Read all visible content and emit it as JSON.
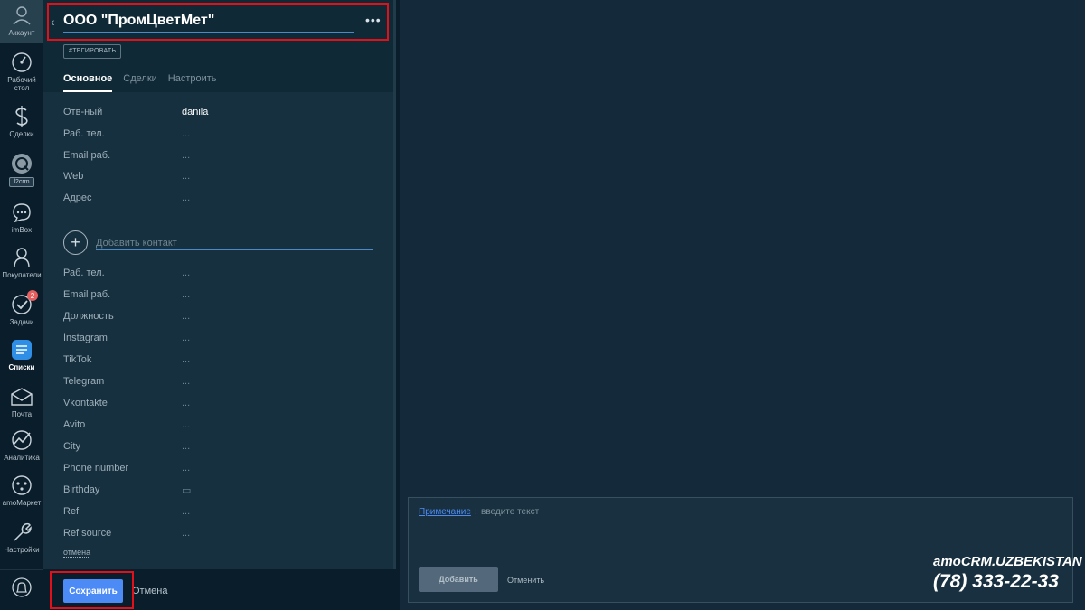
{
  "nav": {
    "account": "Аккаунт",
    "items": [
      {
        "label": "Рабочий стол",
        "icon": "dashboard-icon"
      },
      {
        "label": "Сделки",
        "icon": "dollar-icon"
      },
      {
        "label": "l2crm",
        "icon": "l2crm-icon"
      },
      {
        "label": "imBox",
        "icon": "chat-icon"
      },
      {
        "label": "Покупатели",
        "icon": "customers-icon"
      },
      {
        "label": "Задачи",
        "icon": "tasks-icon",
        "badge": "2"
      },
      {
        "label": "Списки",
        "icon": "lists-icon"
      },
      {
        "label": "Почта",
        "icon": "mail-icon"
      },
      {
        "label": "Аналитика",
        "icon": "analytics-icon"
      },
      {
        "label": "amoМаркет",
        "icon": "market-icon"
      },
      {
        "label": "Настройки",
        "icon": "settings-icon"
      }
    ]
  },
  "card": {
    "title": "ООО \"ПромЦветМет\"",
    "tag_button": "#ТЕГИРОВАТЬ",
    "tabs": [
      "Основное",
      "Сделки",
      "Настроить"
    ],
    "company_fields": [
      {
        "label": "Отв-ный",
        "value": "danila"
      },
      {
        "label": "Раб. тел.",
        "value": "..."
      },
      {
        "label": "Email раб.",
        "value": "..."
      },
      {
        "label": "Web",
        "value": "..."
      },
      {
        "label": "Адрес",
        "value": "..."
      }
    ],
    "add_contact_placeholder": "Добавить контакт",
    "contact_fields": [
      {
        "label": "Раб. тел.",
        "value": "..."
      },
      {
        "label": "Email раб.",
        "value": "..."
      },
      {
        "label": "Должность",
        "value": "..."
      },
      {
        "label": "Instagram",
        "value": "..."
      },
      {
        "label": "TikTok",
        "value": "..."
      },
      {
        "label": "Telegram",
        "value": "..."
      },
      {
        "label": "Vkontakte",
        "value": "..."
      },
      {
        "label": "Avito",
        "value": "..."
      },
      {
        "label": "City",
        "value": "..."
      },
      {
        "label": "Phone number",
        "value": "..."
      },
      {
        "label": "Birthday",
        "value": "▭"
      },
      {
        "label": "Ref",
        "value": "..."
      },
      {
        "label": "Ref source",
        "value": "..."
      }
    ],
    "cancel_link": "отмена"
  },
  "bottom": {
    "save": "Сохранить",
    "cancel": "Отмена"
  },
  "note": {
    "label": "Примечание",
    "placeholder": "введите текст",
    "add": "Добавить",
    "cancel": "Отменить"
  },
  "brand": {
    "name": "amoCRM.UZBEKISTAN",
    "phone": "(78) 333-22-33"
  },
  "colors": {
    "accent": "#4c8bf5",
    "highlight": "#e3101a",
    "badge": "#e55f5f"
  }
}
